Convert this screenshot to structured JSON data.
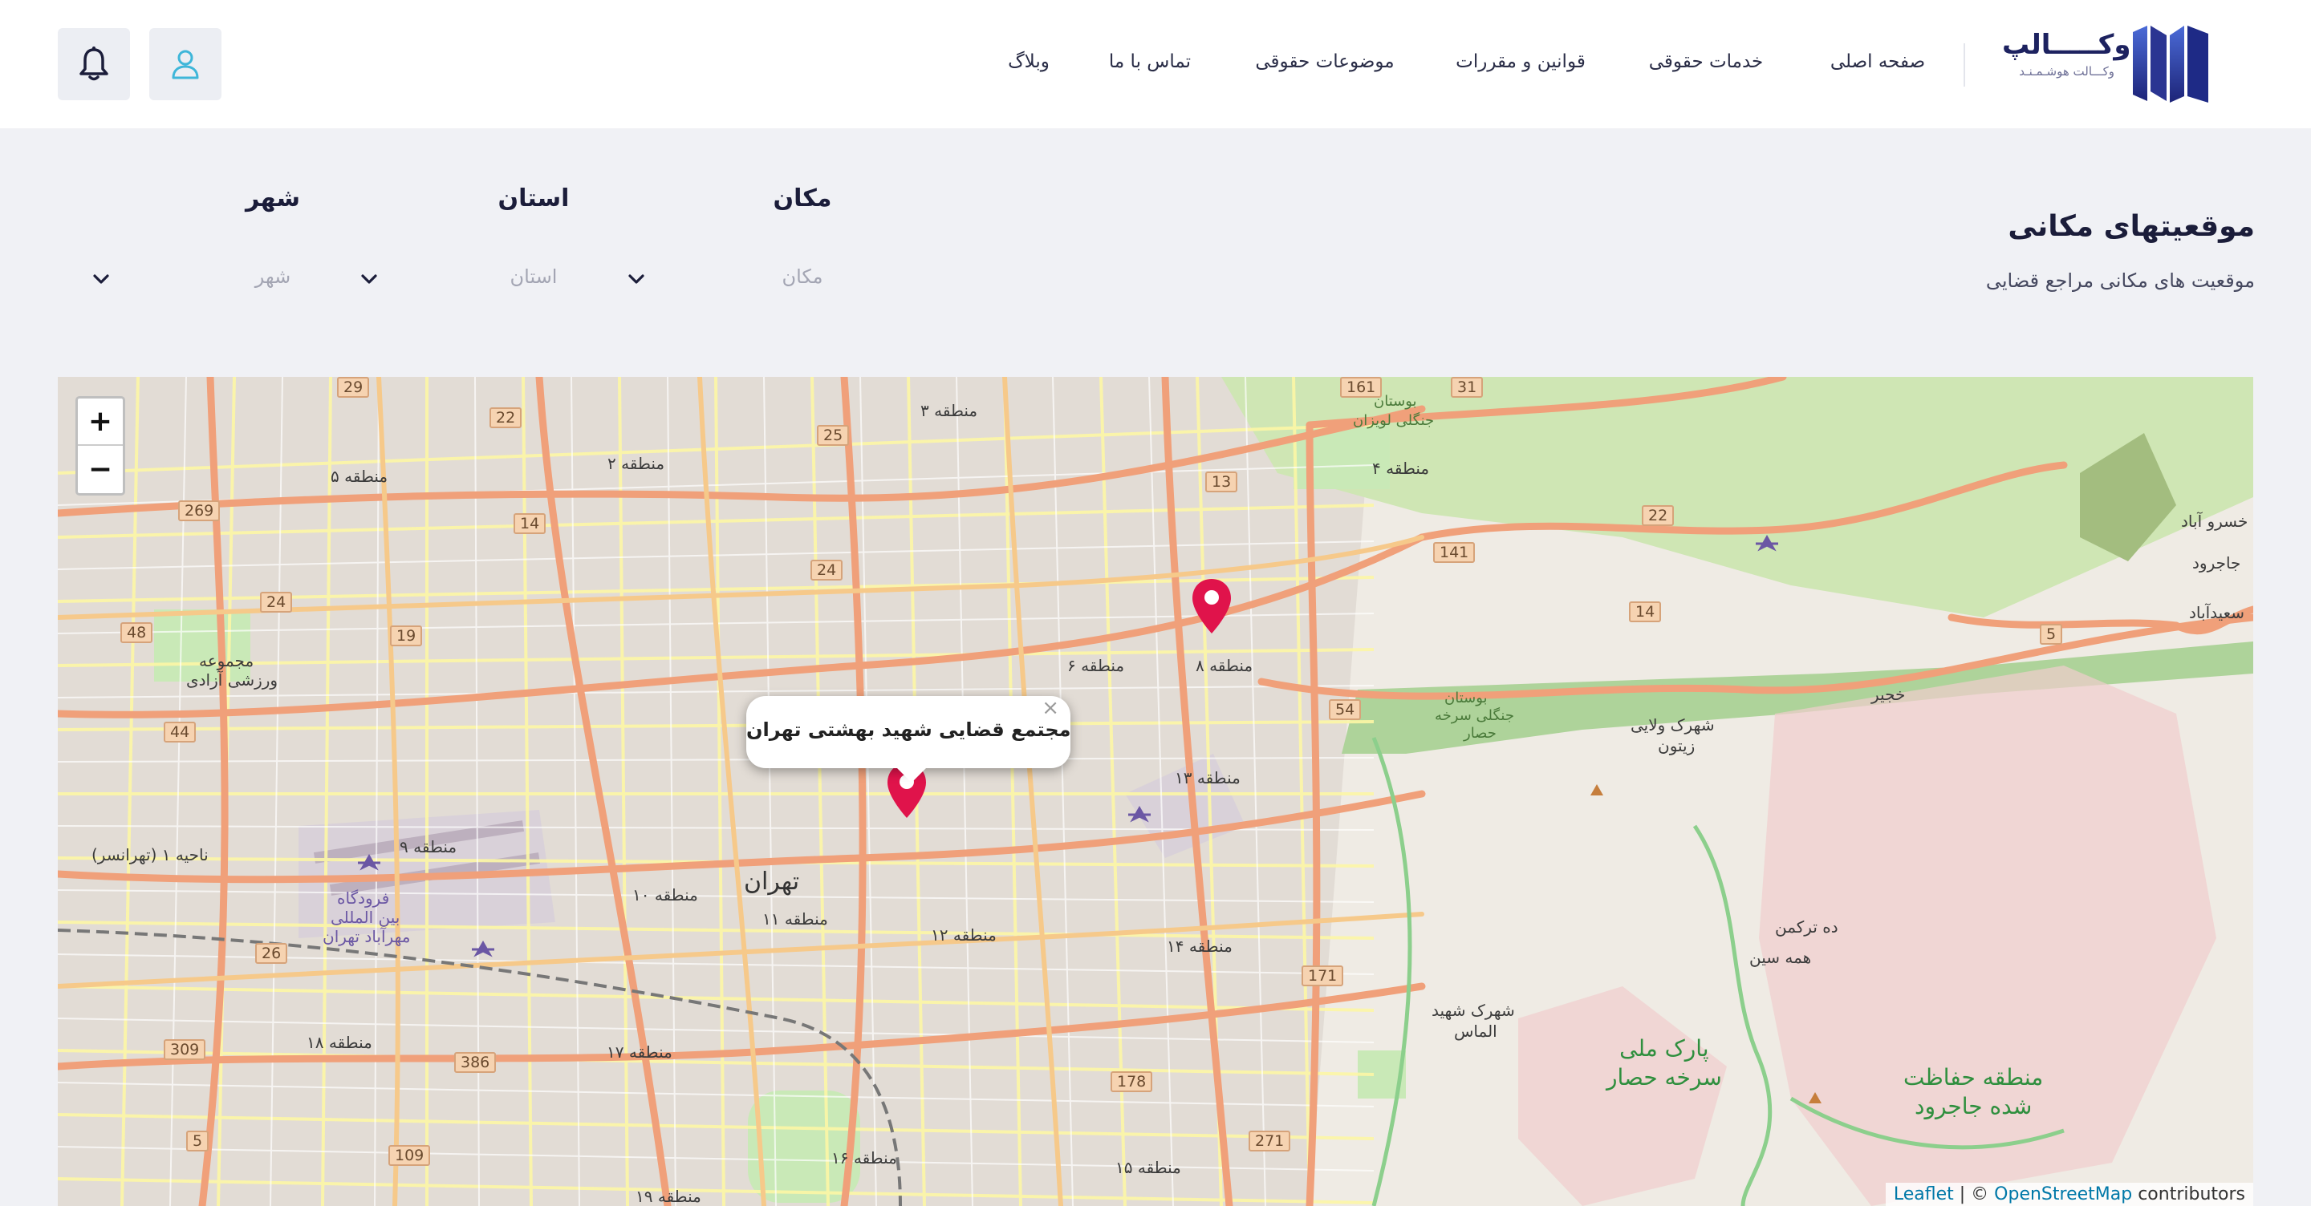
{
  "header": {
    "brand_title": "وکـــــالپ",
    "brand_subtitle": "وکـــالت هوشـمـنـد",
    "nav": [
      {
        "label": "صفحه اصلی"
      },
      {
        "label": "خدمات حقوقی"
      },
      {
        "label": "قوانین و مقررات"
      },
      {
        "label": "موضوعات حقوقی"
      },
      {
        "label": "تماس با ما"
      },
      {
        "label": "وبلاگ"
      }
    ],
    "icons": {
      "user": "user-icon",
      "bell": "bell-icon"
    },
    "accent_color": "#3eb6d9"
  },
  "page": {
    "title": "موقعیتهای مکانی",
    "subtitle": "موقعیت های مکانی مراجع قضایی"
  },
  "filters": [
    {
      "label": "مکان",
      "placeholder": "مکان"
    },
    {
      "label": "استان",
      "placeholder": "استان"
    },
    {
      "label": "شهر",
      "placeholder": "شهر"
    }
  ],
  "map": {
    "zoom_in": "+",
    "zoom_out": "−",
    "popup": {
      "title": "مجتمع قضایی شهید بهشتی تهران",
      "close": "×"
    },
    "marker_color": "#e0134b",
    "attribution": {
      "leaflet": "Leaflet",
      "sep": " | © ",
      "osm": "OpenStreetMap",
      "contributors": " contributors"
    },
    "labels": [
      "منطقه ۳",
      "منطقه ۲",
      "منطقه ۵",
      "منطقه ۴",
      "منطقه ۸",
      "منطقه ۶",
      "منطقه ۱۳",
      "منطقه ۹",
      "منطقه ۱۰",
      "منطقه ۱۱",
      "منطقه ۱۲",
      "منطقه ۱۴",
      "منطقه ۱۸",
      "منطقه ۱۷",
      "منطقه ۱۶",
      "منطقه ۱۵",
      "منطقه ۱۹",
      "تهران",
      "ناحیه ۱ (تهرانسر)",
      "فرودگاه",
      "بین المللی",
      "مهرآباد تهران",
      "مجموعه",
      "ورزشی آزادی",
      "شهرک ولایی",
      "زیتون",
      "ده ترکمن",
      "همه سین",
      "شهرک شهید",
      "الماس",
      "خسرو آباد",
      "جاجرود",
      "سعیدآباد",
      "خجیر",
      "بوستان",
      "جنگلی سرخه",
      "حصار",
      "بوستان",
      "جنگلی لویزان"
    ],
    "green_labels": [
      "پارک ملی",
      "سرخه حصار",
      "منطقه حفاظت",
      "شده جاجرود"
    ],
    "shields": [
      "29",
      "22",
      "25",
      "13",
      "161",
      "31",
      "269",
      "14",
      "24",
      "22",
      "141",
      "48",
      "19",
      "24",
      "14",
      "5",
      "44",
      "54",
      "26",
      "171",
      "309",
      "386",
      "178",
      "271",
      "5",
      "109"
    ]
  }
}
